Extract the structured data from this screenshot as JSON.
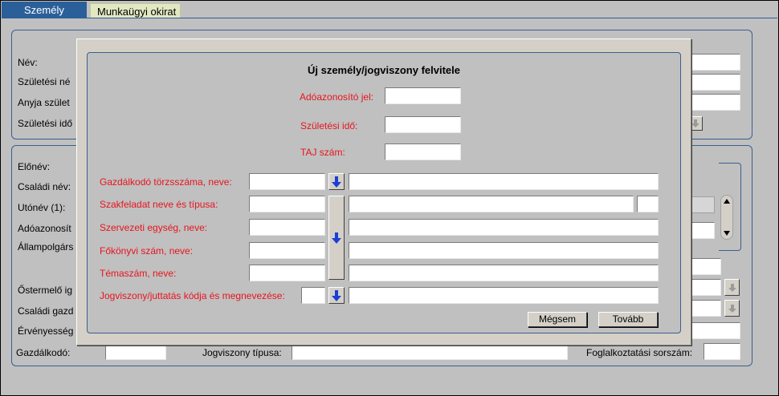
{
  "tabs": [
    {
      "label": "Személy"
    },
    {
      "label": "Munkaügyi okirat"
    }
  ],
  "background": {
    "labels": {
      "nev": "Név:",
      "szuletesi_nev": "Születési né",
      "anyja": "Anyja szület",
      "szuletesi_ido": "Születési idő",
      "elonev": "Előnév:",
      "csaladi_nev": "Családi név:",
      "utonev": "Utónév (1):",
      "adoazonosito": "Adóazonosít",
      "allampolgarsag": "Állampolgárs",
      "ostermelo": "Őstermelő ig",
      "csaladi_gazd": "Családi gazd",
      "ervenyesseg": "Érvényesség",
      "gazdalkodo": "Gazdálkodó:",
      "jogviszony_tipusa": "Jogviszony típusa:",
      "foglalkoztatasi": "Foglalkoztatási sorszám:"
    }
  },
  "dialog": {
    "title": "Új személy/jogviszony felvitele",
    "adoazonosito_label": "Adóazonosító jel:",
    "szuletesi_ido_label": "Születési idő:",
    "taj_label": "TAJ szám:",
    "gazdalkodo_label": "Gazdálkodó törzsszáma, neve:",
    "szakfeladat_label": "Szakfeladat neve és típusa:",
    "szervezeti_label": "Szervezeti egység, neve:",
    "fokonyvi_label": "Főkönyvi szám, neve:",
    "temaszam_label": "Témaszám, neve:",
    "jogviszony_label": "Jogviszony/juttatás kódja és megnevezése:",
    "cancel_label": "Mégsem",
    "next_label": "Tovább"
  },
  "colors": {
    "tab_active": "#2b5f99",
    "tab_inactive": "#e2e8c2",
    "required_label": "#e8141e",
    "arrow_icon": "#1a3fd6"
  }
}
